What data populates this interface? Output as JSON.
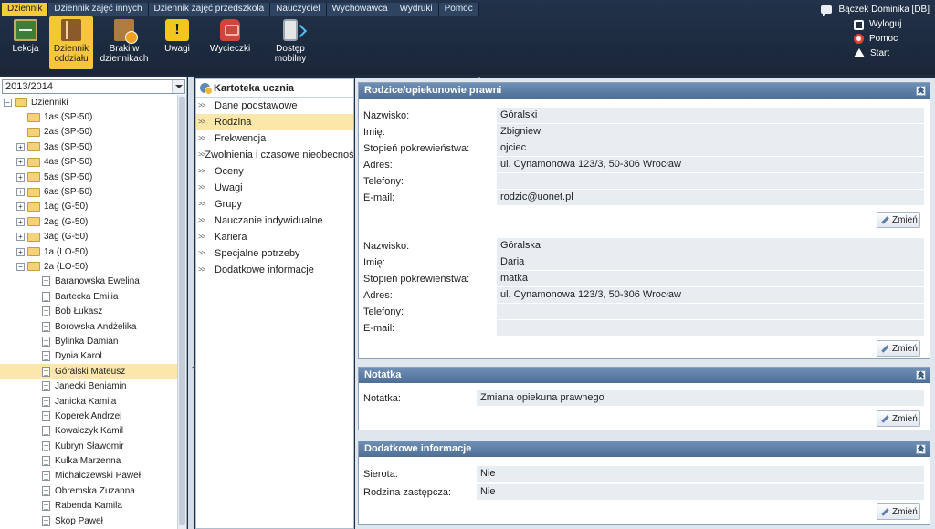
{
  "menu": [
    "Dziennik",
    "Dziennik zajęć innych",
    "Dziennik zajęć przedszkola",
    "Nauczyciel",
    "Wychowawca",
    "Wydruki",
    "Pomoc"
  ],
  "user": {
    "name": "Bączek Dominika [DB]"
  },
  "toolbar": [
    {
      "label": "Lekcja",
      "icon": "blackboard-icon"
    },
    {
      "label": "Dziennik oddziału",
      "icon": "class-journal-icon"
    },
    {
      "label": "Braki w dziennikach",
      "icon": "missing-entries-icon"
    },
    {
      "label": "Uwagi",
      "icon": "warning-icon"
    },
    {
      "label": "Wycieczki",
      "icon": "backpack-icon"
    },
    {
      "label": "Dostęp mobilny",
      "icon": "mobile-phone-icon"
    }
  ],
  "quick": [
    "Wyloguj",
    "Pomoc",
    "Start"
  ],
  "year": "2013/2014",
  "tree": {
    "root": "Dzienniki",
    "classes": [
      "1as (SP-50)",
      "2as (SP-50)",
      "3as (SP-50)",
      "4as (SP-50)",
      "5as (SP-50)",
      "6as (SP-50)",
      "1ag (G-50)",
      "2ag (G-50)",
      "3ag (G-50)",
      "1a (LO-50)",
      "2a (LO-50)"
    ],
    "students": [
      "Baranowska Ewelina",
      "Bartecka Emilia",
      "Bob Łukasz",
      "Borowska Andżelika",
      "Bylinka Damian",
      "Dynia Karol",
      "Góralski Mateusz",
      "Janecki Beniamin",
      "Janicka Kamila",
      "Koperek Andrzej",
      "Kowalczyk Kamil",
      "Kubryn Sławomir",
      "Kulka Marzenna",
      "Michalczewski Paweł",
      "Obremska Zuzanna",
      "Rabenda Kamila",
      "Skop Paweł"
    ]
  },
  "card": {
    "title": "Kartoteka ucznia",
    "items": [
      "Dane podstawowe",
      "Rodzina",
      "Frekwencja",
      "Zwolnienia i czasowe nieobecności",
      "Oceny",
      "Uwagi",
      "Grupy",
      "Nauczanie indywidualne",
      "Kariera",
      "Specjalne potrzeby",
      "Dodatkowe informacje"
    ]
  },
  "labels": {
    "surname": "Nazwisko:",
    "first_name": "Imię:",
    "relation": "Stopień pokrewieństwa:",
    "address": "Adres:",
    "phones": "Telefony:",
    "email": "E-mail:",
    "note": "Notatka:",
    "orphan": "Sierota:",
    "foster": "Rodzina zastępcza:",
    "edit": "Zmień"
  },
  "parents": {
    "title": "Rodzice/opiekunowie prawni",
    "people": [
      {
        "surname": "Góralski",
        "first_name": "Zbigniew",
        "relation": "ojciec",
        "address": "ul. Cynamonowa 123/3, 50-306 Wrocław",
        "phones": "",
        "email": "rodzic@uonet.pl"
      },
      {
        "surname": "Góralska",
        "first_name": "Daria",
        "relation": "matka",
        "address": "ul. Cynamonowa 123/3, 50-306 Wrocław",
        "phones": "",
        "email": ""
      }
    ]
  },
  "note": {
    "title": "Notatka",
    "value": "Zmiana opiekuna prawnego"
  },
  "extra": {
    "title": "Dodatkowe informacje",
    "orphan": "Nie",
    "foster": "Nie"
  },
  "colors": {
    "accent": "#f3c63b",
    "header": "#1e2c3f",
    "panel_head": "#5b7ca3",
    "selection": "#fbe7a9"
  }
}
